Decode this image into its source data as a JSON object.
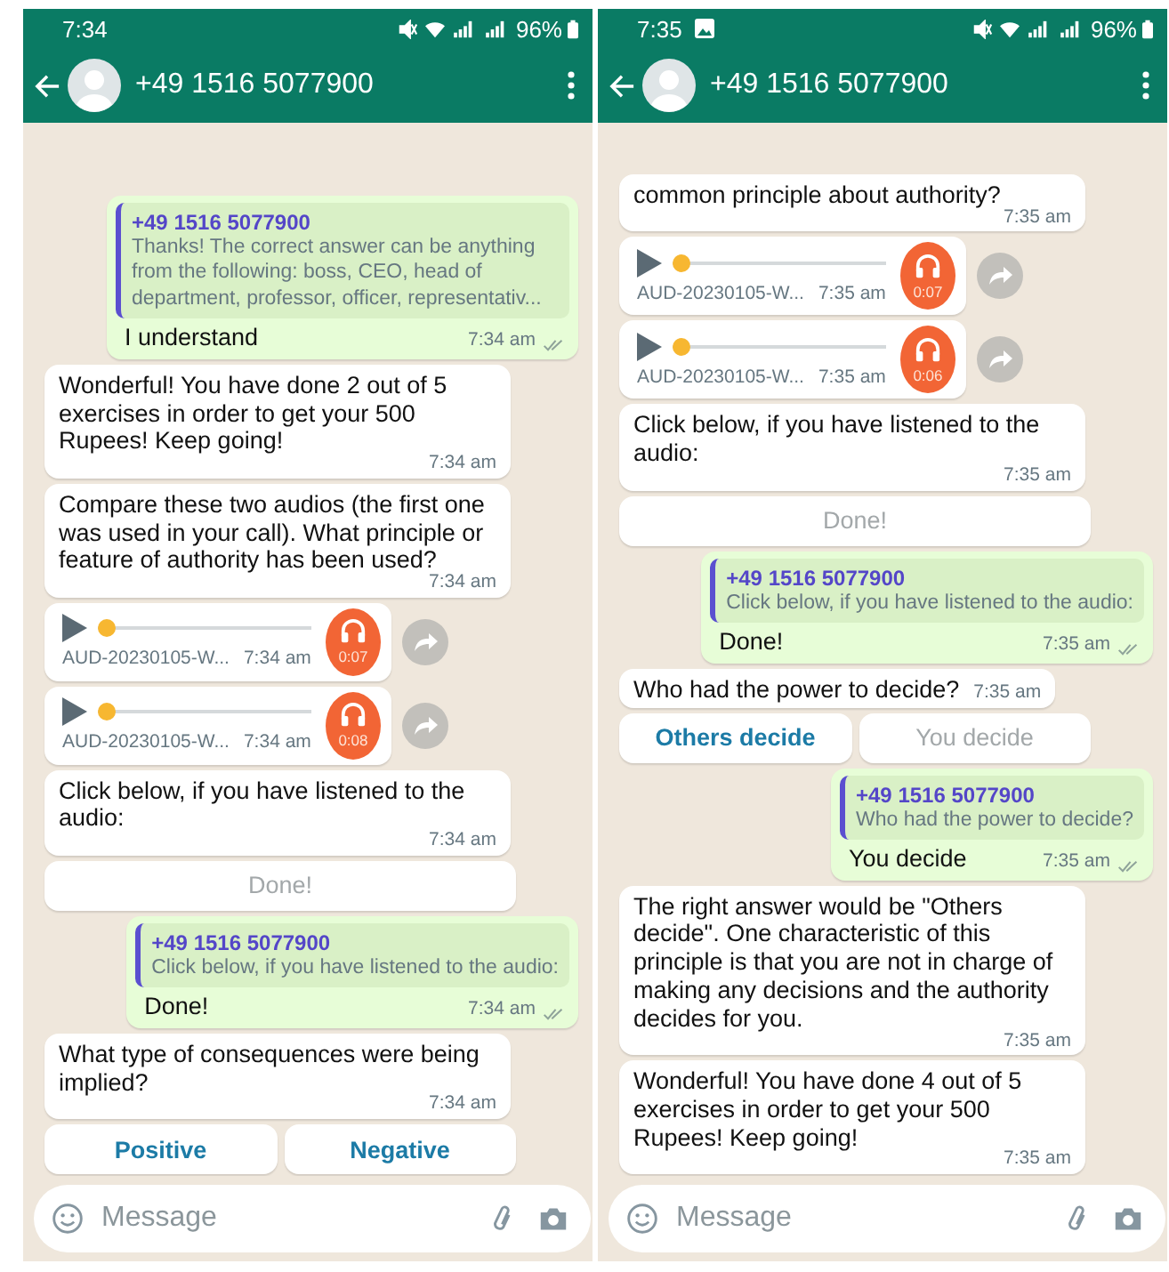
{
  "screens": [
    {
      "status_bar": {
        "time": "7:34",
        "image_notification": false,
        "battery": "96%"
      },
      "header": {
        "title": "+49 1516 5077900"
      },
      "messages": [
        {
          "kind": "outgoing",
          "quote_author": "+49 1516 5077900",
          "quote_text": "Thanks! The correct answer can be anything from the following: boss, CEO, head of department, professor, officer, representativ...",
          "text": "I understand",
          "time": "7:34 am"
        },
        {
          "kind": "incoming",
          "text": "Wonderful! You have done 2 out of 5 exercises in order to get your 500 Rupees! Keep going!",
          "time": "7:34 am"
        },
        {
          "kind": "incoming",
          "text": "Compare these two audios (the first one was used in your call). What principle or feature of authority has been used?",
          "time": "7:34 am"
        },
        {
          "kind": "audio",
          "file": "AUD-20230105-W...",
          "time": "7:34 am",
          "duration": "0:07"
        },
        {
          "kind": "audio",
          "file": "AUD-20230105-W...",
          "time": "7:34 am",
          "duration": "0:08"
        },
        {
          "kind": "incoming",
          "text": "Click below, if you have listened to the audio:",
          "time": "7:34 am"
        },
        {
          "kind": "buttons",
          "buttons": [
            {
              "label": "Done!",
              "disabled": true
            }
          ]
        },
        {
          "kind": "outgoing",
          "quote_author": "+49 1516 5077900",
          "quote_text": "Click below, if you have listened to the audio:",
          "text": "Done!",
          "time": "7:34 am"
        },
        {
          "kind": "incoming",
          "text": "What type of consequences were being implied?",
          "time": "7:34 am"
        },
        {
          "kind": "buttons",
          "buttons": [
            {
              "label": "Positive",
              "disabled": false
            },
            {
              "label": "Negative",
              "disabled": false
            }
          ]
        }
      ],
      "composer": {
        "placeholder": "Message"
      }
    },
    {
      "status_bar": {
        "time": "7:35",
        "image_notification": true,
        "battery": "96%"
      },
      "header": {
        "title": "+49 1516 5077900"
      },
      "messages": [
        {
          "kind": "incoming",
          "text": "common principle about authority?",
          "time": "7:35 am"
        },
        {
          "kind": "audio",
          "file": "AUD-20230105-W...",
          "time": "7:35 am",
          "duration": "0:07"
        },
        {
          "kind": "audio",
          "file": "AUD-20230105-W...",
          "time": "7:35 am",
          "duration": "0:06"
        },
        {
          "kind": "incoming",
          "text": "Click below, if you have listened to the audio:",
          "time": "7:35 am"
        },
        {
          "kind": "buttons",
          "buttons": [
            {
              "label": "Done!",
              "disabled": true
            }
          ]
        },
        {
          "kind": "outgoing",
          "quote_author": "+49 1516 5077900",
          "quote_text": "Click below, if you have listened to the audio:",
          "text": "Done!",
          "time": "7:35 am"
        },
        {
          "kind": "incoming",
          "text": "Who had the power to decide?",
          "time": "7:35 am"
        },
        {
          "kind": "buttons",
          "buttons": [
            {
              "label": "Others decide",
              "disabled": false
            },
            {
              "label": "You decide",
              "disabled": true
            }
          ]
        },
        {
          "kind": "outgoing",
          "quote_author": "+49 1516 5077900",
          "quote_text": "Who had the power to decide?",
          "text": "You decide",
          "time": "7:35 am"
        },
        {
          "kind": "incoming",
          "text": "The right answer would be \"Others decide\". One characteristic of this principle is that you are not in charge of making any decisions and the authority decides for you.",
          "time": "7:35 am"
        },
        {
          "kind": "incoming",
          "text": "Wonderful! You have done 4 out of 5 exercises in order to get your 500 Rupees! Keep going!",
          "time": "7:35 am"
        }
      ],
      "composer": {
        "placeholder": "Message"
      }
    }
  ]
}
